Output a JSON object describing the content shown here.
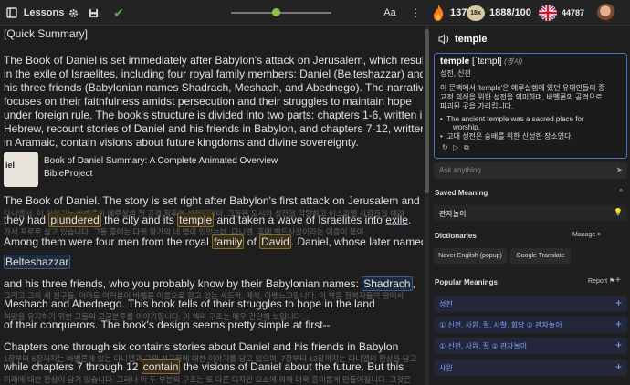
{
  "topbar": {
    "lessons": "Lessons",
    "aa": "Aa",
    "dots": "⋮",
    "streak": "137",
    "level": "18x",
    "progress": "1888/100",
    "lingq_count": "44787",
    "slider_position": 0.41
  },
  "lesson": {
    "summary_heading": "[Quick Summary]",
    "summary": [
      "The Book of Daniel is set immediately after Babylon's attack on Jerusalem, which resulted",
      "in the exile of Israelites, including four royal family members: Daniel (Belteshazzar) and",
      "his three friends (Babylonian names Shadrach, Meshach, and Abednego). The narrative",
      "focuses on their faithfulness amidst persecution and their struggles to maintain hope",
      "under foreign rule. The book's structure is divided into two parts: chapters 1-6, written in",
      "Hebrew, recount stories of Daniel and his friends in Babylon, and chapters 7-12, written",
      "in Aramaic, contain visions about future kingdoms and divine sovereignty."
    ],
    "video_thumb_text": "iel",
    "video_title": "Book of Daniel Summary: A Complete Animated Overview",
    "video_channel": "BibleProject",
    "t1_a": "The Book of Daniel. The story is set right after Babylon's first attack on Jerusalem and",
    "s1": "다니엘서. 이 이야기는 바벨론이 예루살렘 첫 공격 직후에 설정되었다. 그들은 도시와 성전을 약탈하고 이스라엘 사람들을 데려",
    "t2_pre": "they had ",
    "t2_w1": "plundered",
    "t2_mid1": " the city and its ",
    "t2_w2": "temple",
    "t2_mid2": " and taken a wave of Israelites into ",
    "t2_w3": "exile",
    "t2_end": ".",
    "s2": "가서 포로로 삼고 있습니다. 그들 중에는 다윗 왕가의 네 명이 있었는데, 다니엘. 후에 벨드사살이라는 이름이 붙여",
    "t3_pre": "Among them were four men from the royal ",
    "t3_w1": "family",
    "t3_mid": " of ",
    "t3_w2": "David",
    "t3_end": ". Daniel, whose later named",
    "t4_w": "Belteshazzar",
    "t5_pre": "and his three friends, who you probably know by their Babylonian names: ",
    "t5_w": "Shadrach",
    "t5_end": ",",
    "s5": "그리고 그의 세 친구들, 아마도 여러분이 바벨론 이름으로 알고 있는 세드락, 메삭, 아벳느고입니다. 이 책은 정복자들의 땅에서",
    "t6": "Meshach and Abednego. This book tells of their struggles to hope in the land",
    "s6": "희망을 유지하기 위한 그들의 고군분투를 이야기합니다. 이 책의 구조는 매우 간단해 보입니다…",
    "t7": "of their conquerors. The book's design seems pretty simple at first--",
    "t8": "Chapters one through six contains stories about Daniel and his friends in Babylon",
    "s8": "1장부터 6장까지는 바벨론에 있는 다니엘과 그의 친구들에 대한 이야기를 담고 있으며, 7장부터 12장까지는 다니엘의 환상을 담고",
    "t9_pre": "while chapters 7 through 12 ",
    "t9_w": "contain",
    "t9_end": " the visions of Daniel about the future. But this",
    "s9": "미래에 대한 환상이 담겨 있습니다. 그러나 이 두 부분의 구조는 또 다른 디자인 요소에 의해 더욱 흥미롭게 만들어집니다. 그것은"
  },
  "panel": {
    "word": "temple",
    "card_head": "temple",
    "card_ipa": " [ˈtɛmpl] ",
    "card_pos": "(명사)",
    "card_meaning": "성전, 신전",
    "card_desc_1": "이 문맥에서 'temple'은 예루살렘에 있던 유대인들의 종",
    "card_desc_2": "교적 의식을 위한 성전을 의미하며, 바벨론의 공격으로",
    "card_desc_3": "파괴된 곳을 가리킵니다.",
    "card_ex_1": "The ancient temple was a sacred place for",
    "card_ex_1b": "worship.",
    "card_ex_2": "고대 성전은 숭배를 위한 신성한 장소였다.",
    "ask_placeholder": "Ask anything",
    "saved_title": "Saved Meaning",
    "saved_value": "관자놀이",
    "dict_title": "Dictionaries",
    "manage": "Manage",
    "dict_1": "Naver English (popup)",
    "dict_2": "Google Translate",
    "popular_title": "Popular Meanings",
    "report": "Report",
    "meanings": [
      "성전",
      "① 신전, 사원, 절, 사찰, 회당 ② 관자놀이",
      "① 신전, 사원, 절 ② 관자놀이",
      "사원"
    ]
  },
  "colors": {
    "accent": "#4a72c4",
    "highlight": "#8a6d2e",
    "check": "#4caf50"
  }
}
